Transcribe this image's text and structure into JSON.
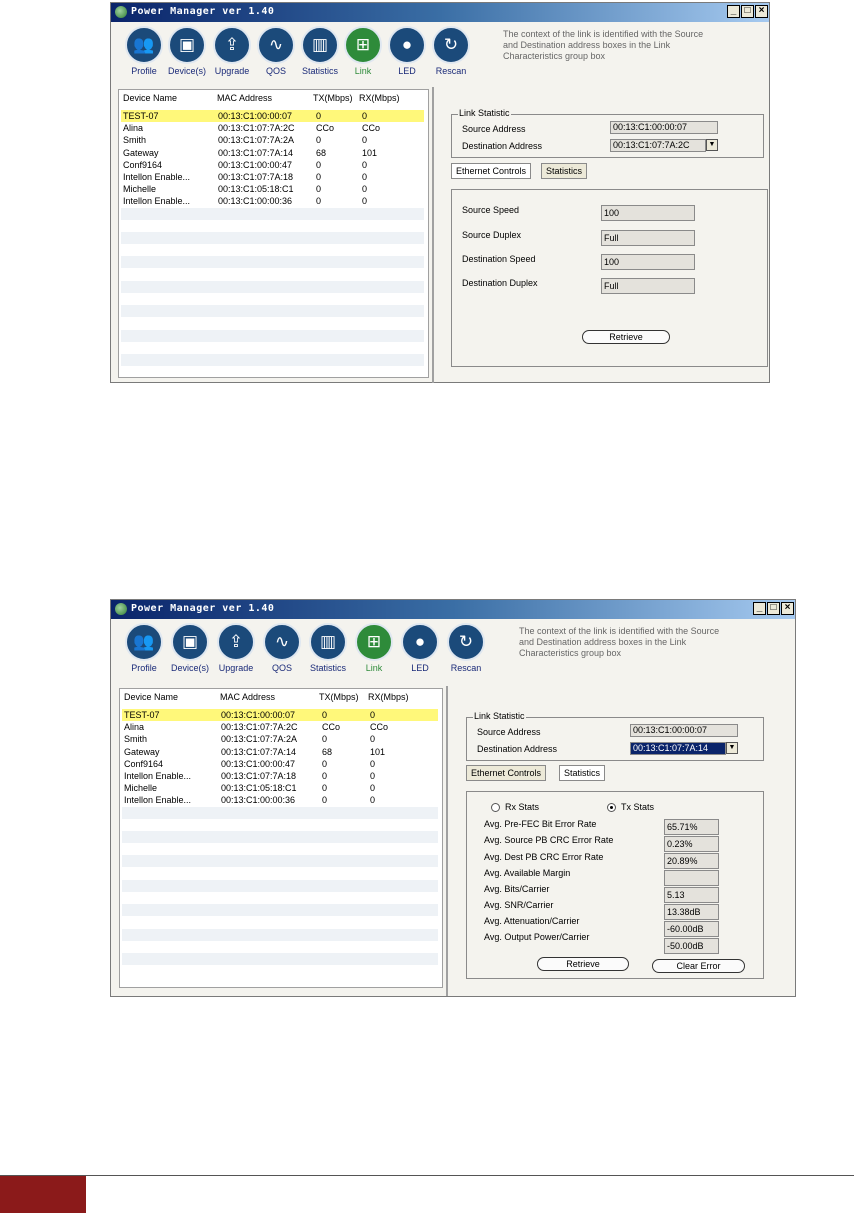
{
  "app": {
    "title": "Power Manager ver 1.40"
  },
  "toolbar": {
    "items": [
      {
        "label": "Profile",
        "icon": "people-icon"
      },
      {
        "label": "Device(s)",
        "icon": "devices-icon"
      },
      {
        "label": "Upgrade",
        "icon": "upgrade-icon"
      },
      {
        "label": "QOS",
        "icon": "waveform-icon"
      },
      {
        "label": "Statistics",
        "icon": "bar-graph-icon"
      },
      {
        "label": "Link",
        "icon": "network-link-icon"
      },
      {
        "label": "LED",
        "icon": "led-icon"
      },
      {
        "label": "Rescan",
        "icon": "rescan-icon"
      }
    ],
    "active": "Link",
    "hint_lines": [
      "The context of the link is identified with the Source",
      "and Destination address boxes in the Link",
      "Characteristics group box"
    ]
  },
  "devices": {
    "columns": [
      "Device Name",
      "MAC Address",
      "TX(Mbps)",
      "RX(Mbps)"
    ],
    "rows": [
      [
        "TEST-07",
        "00:13:C1:00:00:07",
        "0",
        "0"
      ],
      [
        "Alina",
        "00:13:C1:07:7A:2C",
        "CCo",
        "CCo"
      ],
      [
        "Smith",
        "00:13:C1:07:7A:2A",
        "0",
        "0"
      ],
      [
        "Gateway",
        "00:13:C1:07:7A:14",
        "68",
        "101"
      ],
      [
        "Conf9164",
        "00:13:C1:00:00:47",
        "0",
        "0"
      ],
      [
        "Intellon Enable...",
        "00:13:C1:07:7A:18",
        "0",
        "0"
      ],
      [
        "Michelle",
        "00:13:C1:05:18:C1",
        "0",
        "0"
      ],
      [
        "Intellon Enable...",
        "00:13:C1:00:00:36",
        "0",
        "0"
      ]
    ]
  },
  "link": {
    "group_title": "Link Statistic",
    "source_label": "Source Address",
    "dest_label": "Destination Address",
    "source_value": "00:13:C1:00:00:07",
    "dest_value_1": "00:13:C1:07:7A:2C",
    "dest_value_2": "00:13:C1:07:7A:14",
    "tabs": [
      "Ethernet Controls",
      "Statistics"
    ]
  },
  "ethernet": {
    "fields": [
      {
        "label": "Source Speed",
        "value": "100"
      },
      {
        "label": "Source Duplex",
        "value": "Full"
      },
      {
        "label": "Destination Speed",
        "value": "100"
      },
      {
        "label": "Destination Duplex",
        "value": "Full"
      }
    ],
    "retrieve": "Retrieve"
  },
  "stats": {
    "rx_label": "Rx Stats",
    "tx_label": "Tx Stats",
    "selected": "Tx Stats",
    "fields": [
      {
        "label": "Avg. Pre-FEC Bit Error Rate",
        "value": "65.71%"
      },
      {
        "label": "Avg. Source PB CRC Error Rate",
        "value": "0.23%"
      },
      {
        "label": "Avg. Dest PB CRC Error Rate",
        "value": "20.89%"
      },
      {
        "label": "Avg. Available Margin",
        "value": ""
      },
      {
        "label": "Avg. Bits/Carrier",
        "value": "5.13"
      },
      {
        "label": "Avg. SNR/Carrier",
        "value": "13.38dB"
      },
      {
        "label": "Avg. Attenuation/Carrier",
        "value": "-60.00dB"
      },
      {
        "label": "Avg. Output Power/Carrier",
        "value": "-50.00dB"
      }
    ],
    "retrieve": "Retrieve",
    "clear": "Clear Error"
  }
}
